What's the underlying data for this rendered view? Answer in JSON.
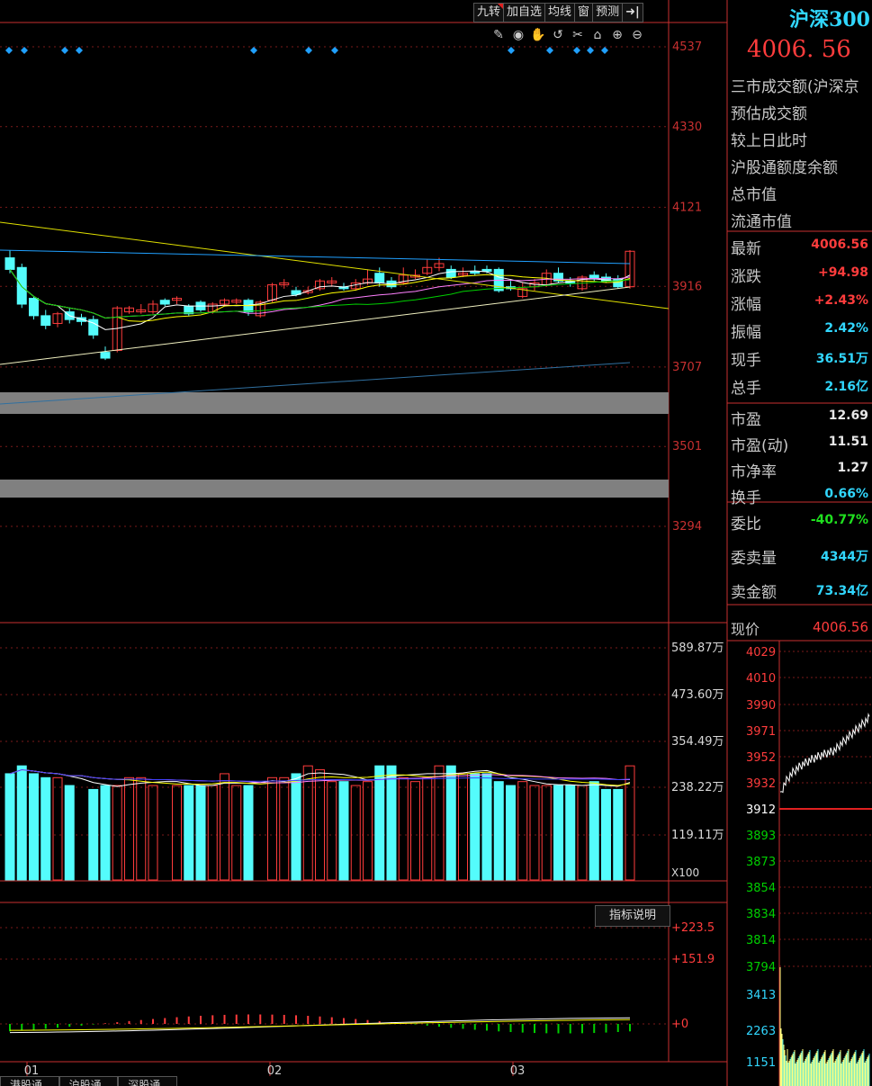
{
  "toolbar": {
    "buttons": [
      "九转",
      "加自选",
      "均线",
      "窗",
      "预测"
    ],
    "arrow_label": "➜|"
  },
  "colors": {
    "up": "#ff3c3c",
    "down": "#54fcfc",
    "grid": "#7a1a1a",
    "axis": "#c83030",
    "ma5": "#ffffff",
    "ma10": "#ffff00",
    "ma20": "#ff80ff",
    "ma30": "#00d000",
    "ma60": "#20a0ff"
  },
  "title": {
    "name": "沪深300",
    "price": "4006. 56"
  },
  "price_axis": [
    "4537",
    "4330",
    "4121",
    "3916",
    "3707",
    "3501",
    "3294"
  ],
  "volume_axis": [
    "589.87万",
    "473.60万",
    "354.49万",
    "238.22万",
    "119.11万"
  ],
  "volume_unit": "X100",
  "macd_axis": [
    "+223.5",
    "+151.9",
    "+0"
  ],
  "indicator_button": "指标说明",
  "month_labels": [
    "01",
    "02",
    "03"
  ],
  "bottom_tabs": [
    "港股通..",
    "沪股通..",
    "深股通.."
  ],
  "info_rows": [
    {
      "label": "三市成交额(沪深京"
    },
    {
      "label": "预估成交额"
    },
    {
      "label": "较上日此时"
    },
    {
      "label": "沪股通额度余额"
    },
    {
      "label": "总市值"
    },
    {
      "label": "流通市值"
    }
  ],
  "quote_rows": [
    {
      "label": "最新",
      "value": "4006.56",
      "color": "red"
    },
    {
      "label": "涨跌",
      "value": "+94.98",
      "color": "red"
    },
    {
      "label": "涨幅",
      "value": "+2.43%",
      "color": "red"
    },
    {
      "label": "振幅",
      "value": "2.42%",
      "color": "cyan"
    },
    {
      "label": "现手",
      "value": "36.51万",
      "color": "cyan"
    },
    {
      "label": "总手",
      "value": "2.16亿",
      "color": "cyan"
    }
  ],
  "valuation_rows": [
    {
      "label": "市盈",
      "value": "12.69",
      "color": "white"
    },
    {
      "label": "市盈(动)",
      "value": "11.51",
      "color": "white"
    },
    {
      "label": "市净率",
      "value": "1.27",
      "color": "white"
    },
    {
      "label": "换手",
      "value": "0.66%",
      "color": "cyan"
    }
  ],
  "order_rows": [
    {
      "label": "委比",
      "value": "-40.77%",
      "color": "green"
    },
    {
      "label": "委卖量",
      "value": "4344万",
      "color": "cyan"
    },
    {
      "label": "卖金额",
      "value": "73.34亿",
      "color": "cyan"
    }
  ],
  "current_price": {
    "label": "现价",
    "value": "4006.56"
  },
  "intraday_axis": [
    "4029",
    "4010",
    "3990",
    "3971",
    "3952",
    "3932",
    "3912",
    "3893",
    "3873",
    "3854",
    "3834",
    "3814",
    "3794"
  ],
  "intraday_vol_axis": [
    "3413",
    "2263",
    "1151"
  ],
  "chart_data": {
    "type": "candlestick",
    "price_range": [
      3294,
      4537
    ],
    "candles": [
      {
        "o": 3990,
        "c": 3960,
        "h": 4010,
        "l": 3950
      },
      {
        "o": 3965,
        "c": 3870,
        "h": 3975,
        "l": 3860
      },
      {
        "o": 3885,
        "c": 3840,
        "h": 3890,
        "l": 3830
      },
      {
        "o": 3840,
        "c": 3815,
        "h": 3855,
        "l": 3805
      },
      {
        "o": 3820,
        "c": 3845,
        "h": 3850,
        "l": 3810
      },
      {
        "o": 3850,
        "c": 3830,
        "h": 3860,
        "l": 3820
      },
      {
        "o": 3835,
        "c": 3825,
        "h": 3845,
        "l": 3815
      },
      {
        "o": 3830,
        "c": 3790,
        "h": 3840,
        "l": 3780
      },
      {
        "o": 3745,
        "c": 3730,
        "h": 3760,
        "l": 3725
      },
      {
        "o": 3750,
        "c": 3860,
        "h": 3865,
        "l": 3745
      },
      {
        "o": 3850,
        "c": 3860,
        "h": 3865,
        "l": 3845
      },
      {
        "o": 3850,
        "c": 3855,
        "h": 3870,
        "l": 3845
      },
      {
        "o": 3850,
        "c": 3870,
        "h": 3880,
        "l": 3845
      },
      {
        "o": 3880,
        "c": 3870,
        "h": 3885,
        "l": 3865
      },
      {
        "o": 3880,
        "c": 3885,
        "h": 3890,
        "l": 3870
      },
      {
        "o": 3865,
        "c": 3845,
        "h": 3870,
        "l": 3840
      },
      {
        "o": 3875,
        "c": 3855,
        "h": 3880,
        "l": 3850
      },
      {
        "o": 3850,
        "c": 3870,
        "h": 3875,
        "l": 3845
      },
      {
        "o": 3870,
        "c": 3880,
        "h": 3885,
        "l": 3865
      },
      {
        "o": 3875,
        "c": 3880,
        "h": 3885,
        "l": 3870
      },
      {
        "o": 3880,
        "c": 3850,
        "h": 3885,
        "l": 3840
      },
      {
        "o": 3840,
        "c": 3875,
        "h": 3880,
        "l": 3835
      },
      {
        "o": 3880,
        "c": 3920,
        "h": 3925,
        "l": 3875
      },
      {
        "o": 3920,
        "c": 3925,
        "h": 3935,
        "l": 3910
      },
      {
        "o": 3905,
        "c": 3895,
        "h": 3915,
        "l": 3890
      },
      {
        "o": 3900,
        "c": 3905,
        "h": 3915,
        "l": 3895
      },
      {
        "o": 3910,
        "c": 3930,
        "h": 3935,
        "l": 3905
      },
      {
        "o": 3925,
        "c": 3930,
        "h": 3940,
        "l": 3915
      },
      {
        "o": 3915,
        "c": 3910,
        "h": 3925,
        "l": 3905
      },
      {
        "o": 3910,
        "c": 3925,
        "h": 3935,
        "l": 3905
      },
      {
        "o": 3925,
        "c": 3935,
        "h": 3960,
        "l": 3920
      },
      {
        "o": 3950,
        "c": 3925,
        "h": 3965,
        "l": 3915
      },
      {
        "o": 3930,
        "c": 3915,
        "h": 3940,
        "l": 3910
      },
      {
        "o": 3925,
        "c": 3945,
        "h": 3965,
        "l": 3920
      },
      {
        "o": 3940,
        "c": 3945,
        "h": 3960,
        "l": 3935
      },
      {
        "o": 3950,
        "c": 3965,
        "h": 3985,
        "l": 3945
      },
      {
        "o": 3965,
        "c": 3975,
        "h": 3990,
        "l": 3955
      },
      {
        "o": 3960,
        "c": 3940,
        "h": 3970,
        "l": 3935
      },
      {
        "o": 3945,
        "c": 3950,
        "h": 3965,
        "l": 3940
      },
      {
        "o": 3955,
        "c": 3950,
        "h": 3970,
        "l": 3945
      },
      {
        "o": 3960,
        "c": 3955,
        "h": 3970,
        "l": 3950
      },
      {
        "o": 3960,
        "c": 3905,
        "h": 3965,
        "l": 3900
      },
      {
        "o": 3915,
        "c": 3910,
        "h": 3930,
        "l": 3905
      },
      {
        "o": 3890,
        "c": 3910,
        "h": 3925,
        "l": 3885
      },
      {
        "o": 3915,
        "c": 3925,
        "h": 3935,
        "l": 3905
      },
      {
        "o": 3920,
        "c": 3950,
        "h": 3960,
        "l": 3915
      },
      {
        "o": 3950,
        "c": 3930,
        "h": 3965,
        "l": 3925
      },
      {
        "o": 3930,
        "c": 3925,
        "h": 3940,
        "l": 3915
      },
      {
        "o": 3910,
        "c": 3940,
        "h": 3945,
        "l": 3905
      },
      {
        "o": 3945,
        "c": 3935,
        "h": 3955,
        "l": 3930
      },
      {
        "o": 3940,
        "c": 3930,
        "h": 3950,
        "l": 3925
      },
      {
        "o": 3935,
        "c": 3915,
        "h": 3945,
        "l": 3910
      },
      {
        "o": 3915,
        "c": 4007,
        "h": 4010,
        "l": 3910
      }
    ],
    "volumes": [
      2.7,
      2.9,
      2.7,
      2.6,
      2.6,
      2.4,
      0,
      2.3,
      2.4,
      2.4,
      2.6,
      2.6,
      2.4,
      0,
      2.4,
      2.4,
      2.4,
      2.4,
      2.7,
      2.4,
      2.4,
      0,
      2.6,
      2.6,
      2.7,
      2.9,
      2.8,
      2.5,
      2.5,
      2.4,
      2.5,
      2.9,
      2.9,
      2.6,
      2.5,
      2.6,
      2.9,
      2.9,
      2.7,
      2.7,
      2.7,
      2.5,
      2.4,
      2.5,
      2.4,
      2.4,
      2.4,
      2.4,
      2.4,
      2.5,
      2.3,
      2.3,
      2.9
    ],
    "volume_range": [
      0,
      5.9
    ],
    "macd_range": [
      -60,
      223.5
    ]
  }
}
